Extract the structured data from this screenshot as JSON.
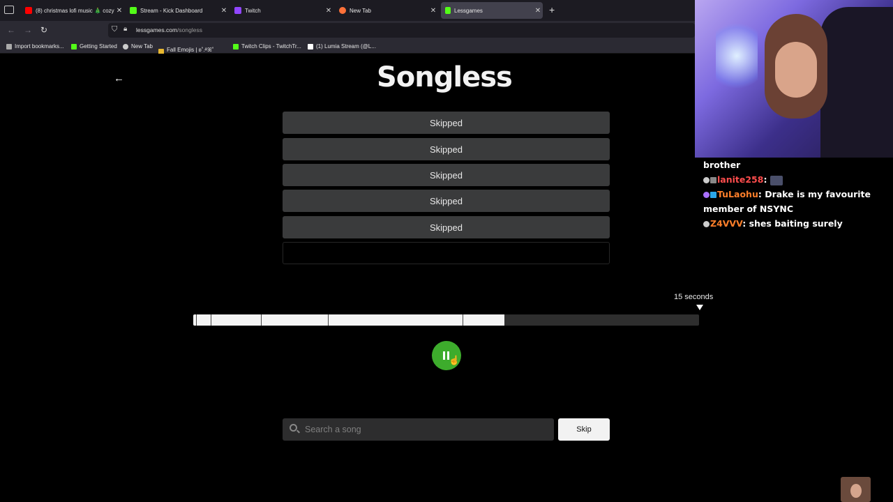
{
  "browser": {
    "tabs": [
      {
        "label": "(8) christmas lofi music 🎄 cozy",
        "color": "#ff0000",
        "active": false
      },
      {
        "label": "Stream - Kick Dashboard",
        "color": "#53fc18",
        "active": false
      },
      {
        "label": "Twitch",
        "color": "#9146ff",
        "active": false
      },
      {
        "label": "New Tab",
        "color": "#ff7139",
        "active": false
      },
      {
        "label": "Lessgames",
        "color": "#53fc18",
        "active": true
      }
    ],
    "url_host": "lessgames.com",
    "url_path": "/songless",
    "bookmarks": [
      "Import bookmarks...",
      "Getting Started",
      "New Tab",
      "Fall Emojis | ʚ˚.࿔ꕤ˚",
      "Twitch Clips - TwitchTr...",
      "(1) Lumia Stream (@L..."
    ]
  },
  "game": {
    "title": "Songless",
    "guesses": [
      "Skipped",
      "Skipped",
      "Skipped",
      "Skipped",
      "Skipped",
      ""
    ],
    "seconds_label": "15 seconds",
    "progress_fraction": 0.615,
    "play_state": "pause-icon",
    "search_placeholder": "Search a song",
    "skip_label": "Skip"
  },
  "chat": {
    "lines": [
      {
        "name": "",
        "text": "brother",
        "name_color": "#ffffff"
      },
      {
        "name": "lanite258",
        "text": ":",
        "name_color": "#ff4d4d"
      },
      {
        "name": "TuLaohu",
        "text": ": Drake is my favourite member of NSYNC",
        "name_color": "#ff7f2a"
      },
      {
        "name": "Z4VVV",
        "text": ": shes baiting surely",
        "name_color": "#ff7f2a"
      }
    ]
  },
  "colors": {
    "play_button": "#3dac2c",
    "guess_bg": "#3a3b3c"
  }
}
